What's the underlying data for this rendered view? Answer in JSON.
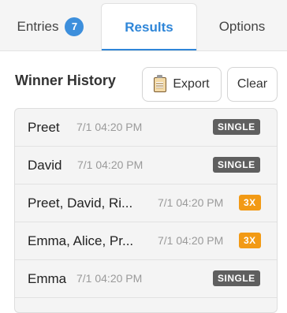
{
  "tabs": {
    "entries": {
      "label": "Entries",
      "count": "7"
    },
    "results": {
      "label": "Results"
    },
    "options": {
      "label": "Options"
    }
  },
  "section": {
    "title": "Winner History"
  },
  "toolbar": {
    "export_label": "Export",
    "export_icon": "clipboard-icon",
    "clear_label": "Clear"
  },
  "history": [
    {
      "names": "Preet",
      "time": "7/1 04:20 PM",
      "badge": "SINGLE",
      "type": "single"
    },
    {
      "names": "David",
      "time": "7/1 04:20 PM",
      "badge": "SINGLE",
      "type": "single"
    },
    {
      "names": "Preet, David, Ri...",
      "time": "7/1 04:20 PM",
      "badge": "3X",
      "type": "multi"
    },
    {
      "names": "Emma, Alice, Pr...",
      "time": "7/1 04:20 PM",
      "badge": "3X",
      "type": "multi"
    },
    {
      "names": "Emma",
      "time": "7/1 04:20 PM",
      "badge": "SINGLE",
      "type": "single"
    }
  ],
  "colors": {
    "accent": "#2f86d8",
    "single_badge": "#5f5f5f",
    "multi_badge": "#f29a15"
  }
}
